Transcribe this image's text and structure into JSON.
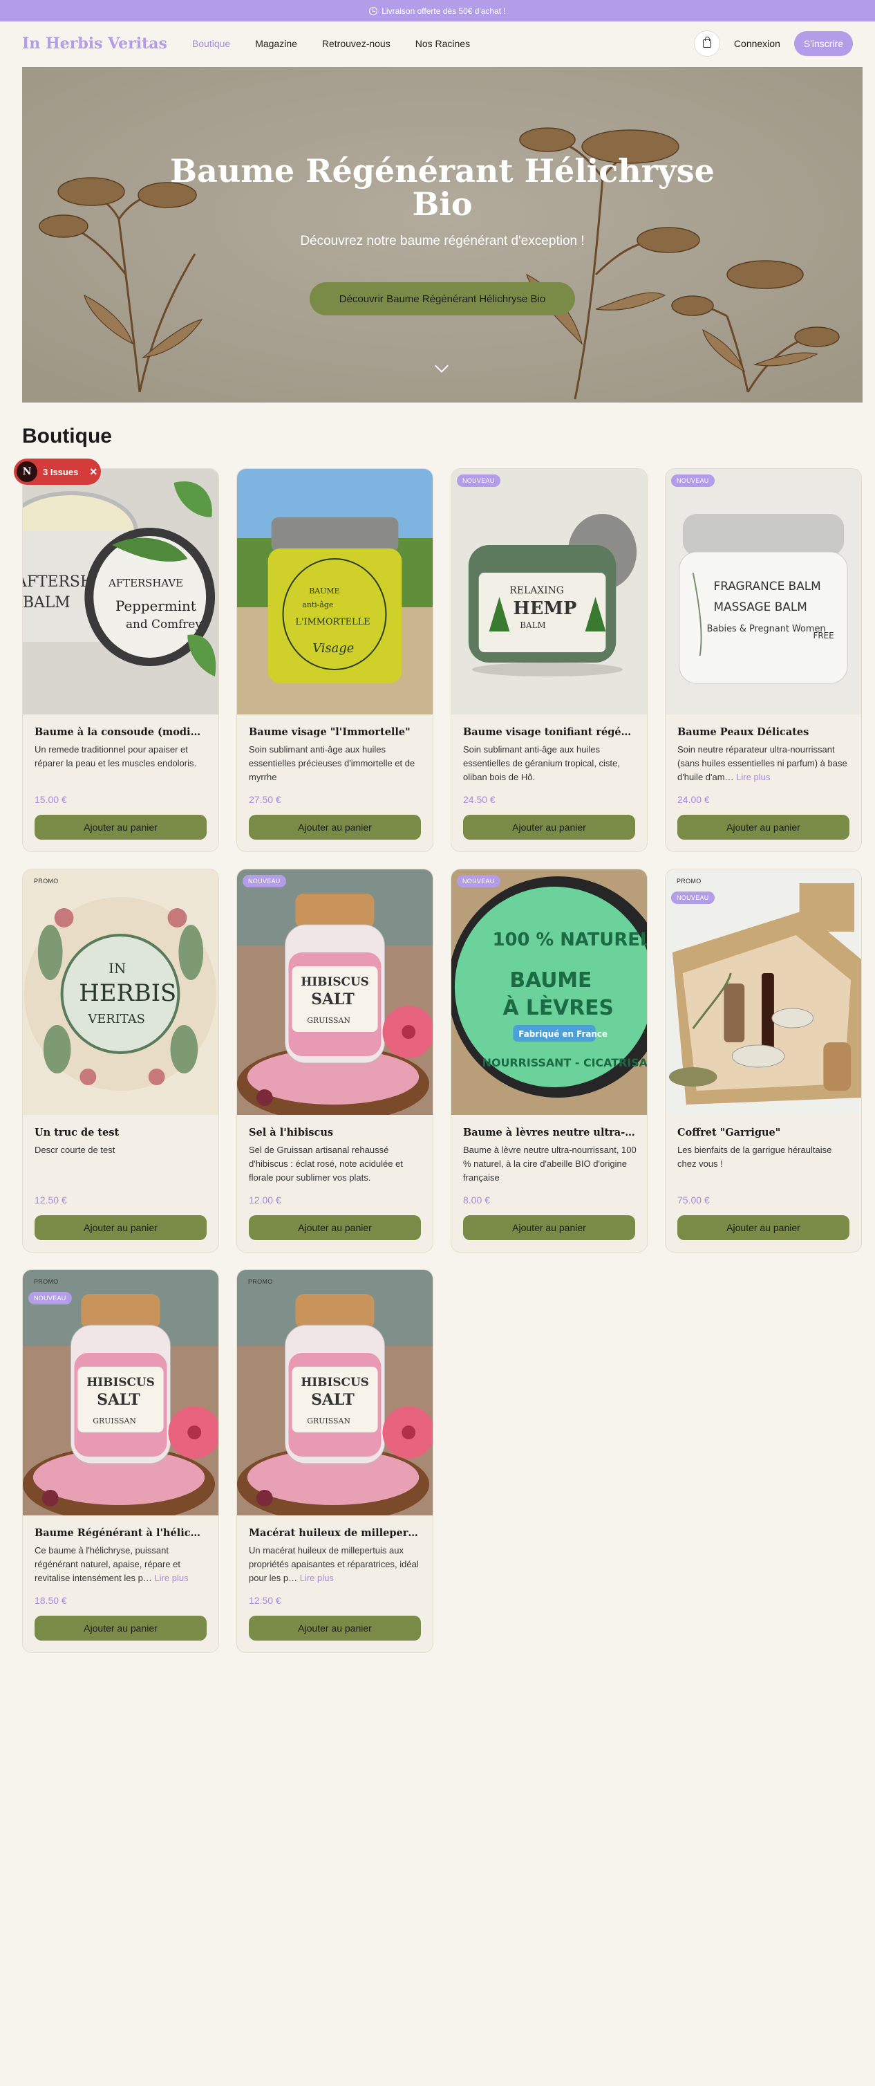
{
  "promo_bar": {
    "text": "Livraison offerte dès 50€ d'achat !"
  },
  "nav": {
    "logo": "In Herbis Veritas",
    "links": [
      "Boutique",
      "Magazine",
      "Retrouvez-nous",
      "Nos Racines"
    ],
    "login": "Connexion",
    "signup": "S'inscrire"
  },
  "hero": {
    "title_line1": "Baume Régénérant Hélichryse",
    "title_line2": "Bio",
    "subtitle": "Découvrez notre baume régénérant d'exception !",
    "cta": "Découvrir Baume Régénérant Hélichryse Bio"
  },
  "section_title": "Boutique",
  "issues": {
    "label": "3 Issues",
    "avatar": "N"
  },
  "add_label": "Ajouter au panier",
  "more_label": "Lire plus",
  "badges": {
    "new": "NOUVEAU",
    "promo": "PROMO"
  },
  "products": [
    {
      "name": "Baume à la consoude (modifié)",
      "desc": "Un remede traditionnel pour apaiser et réparer la peau et les muscles endoloris.",
      "price": "15.00 €",
      "image": "aftershave-balm-jar"
    },
    {
      "name": "Baume visage \"l'Immortelle\"",
      "desc": "Soin sublimant anti-âge aux huiles essentielles précieuses d'immortelle et de myrrhe",
      "price": "27.50 €",
      "image": "immortelle-jar"
    },
    {
      "name": "Baume visage tonifiant régénérant",
      "desc": "Soin sublimant anti-âge aux huiles essentielles de géranium tropical, ciste, oliban bois de Hô.",
      "price": "24.50 €",
      "image": "hemp-balm-jar",
      "badge_new": true
    },
    {
      "name": "Baume Peaux Délicates",
      "desc": "Soin neutre réparateur ultra-nourrissant (sans huiles essentielles ni parfum) à base d'huile d'am…",
      "price": "24.00 €",
      "image": "fragrance-free-balm",
      "badge_new": true,
      "more": true
    },
    {
      "name": "Un truc de test",
      "desc": "Descr courte de test",
      "price": "12.50 €",
      "image": "herbis-veritas-logo",
      "badge_promo": true
    },
    {
      "name": "Sel à l'hibiscus",
      "desc": "Sel de Gruissan artisanal rehaussé d'hibiscus : éclat rosé, note acidulée et florale pour sublimer vos plats.",
      "price": "12.00 €",
      "image": "hibiscus-salt",
      "badge_new": true
    },
    {
      "name": "Baume à lèvres neutre ultra-…",
      "desc": "Baume à lèvre neutre ultra-nourrissant, 100 % naturel, à la cire d'abeille BIO d'origine française",
      "price": "8.00 €",
      "image": "lip-balm-tin",
      "badge_new": true
    },
    {
      "name": "Coffret \"Garrigue\"",
      "desc": "Les bienfaits de la garrigue héraultaise chez vous !",
      "price": "75.00 €",
      "image": "gift-box",
      "badge_promo": true,
      "badge_new": true
    },
    {
      "name": "Baume Régénérant à l'hélichryse…",
      "desc": "Ce baume à l'hélichryse, puissant régénérant naturel, apaise, répare et revitalise intensément les p…",
      "price": "18.50 €",
      "image": "hibiscus-salt",
      "badge_promo": true,
      "badge_new": true,
      "more": true
    },
    {
      "name": "Macérat huileux de millepertuis",
      "desc": "Un macérat huileux de millepertuis aux propriétés apaisantes et réparatrices, idéal pour les p…",
      "price": "12.50 €",
      "image": "hibiscus-salt",
      "badge_promo": true,
      "more": true
    }
  ]
}
